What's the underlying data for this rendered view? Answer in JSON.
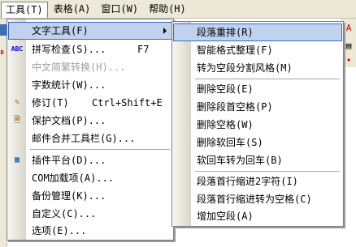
{
  "menubar": {
    "items": [
      {
        "label": "工具(T)"
      },
      {
        "label": "表格(A)"
      },
      {
        "label": "窗口(W)"
      },
      {
        "label": "帮助(H)"
      }
    ]
  },
  "tools_menu": {
    "items": [
      {
        "label": "文字工具(F)",
        "shortcut": ""
      },
      {
        "label": "拼写检查(S)...",
        "shortcut": "F7"
      },
      {
        "label": "中文简繁转换(H)...",
        "shortcut": ""
      },
      {
        "label": "字数统计(W)...",
        "shortcut": ""
      },
      {
        "label": "修订(T)",
        "shortcut": "Ctrl+Shift+E"
      },
      {
        "label": "保护文档(P)...",
        "shortcut": ""
      },
      {
        "label": "邮件合并工具栏(G)...",
        "shortcut": ""
      },
      {
        "label": "插件平台(D)...",
        "shortcut": ""
      },
      {
        "label": "COM加载项(A)...",
        "shortcut": ""
      },
      {
        "label": "备份管理(K)...",
        "shortcut": ""
      },
      {
        "label": "自定义(C)...",
        "shortcut": ""
      },
      {
        "label": "选项(E)...",
        "shortcut": ""
      }
    ]
  },
  "text_tools_menu": {
    "items": [
      {
        "label": "段落重排(R)"
      },
      {
        "label": "智能格式整理(F)"
      },
      {
        "label": "转为空段分割风格(M)"
      },
      {
        "label": "删除空段(E)"
      },
      {
        "label": "删除段首空格(P)"
      },
      {
        "label": "删除空格(W)"
      },
      {
        "label": "删除软回车(S)"
      },
      {
        "label": "软回车转为回车(B)"
      },
      {
        "label": "段落首行缩进2字符(I)"
      },
      {
        "label": "段落首行缩进转为空格(C)"
      },
      {
        "label": "增加空段(A)"
      }
    ]
  },
  "icons": {
    "spell_check": "ABC",
    "revision": "✎",
    "protect": "🗎",
    "plugin": "▦"
  },
  "colors": {
    "highlight_fill": "#c1d2ee",
    "highlight_border": "#316ac5",
    "disabled_text": "#a0a0a0"
  }
}
